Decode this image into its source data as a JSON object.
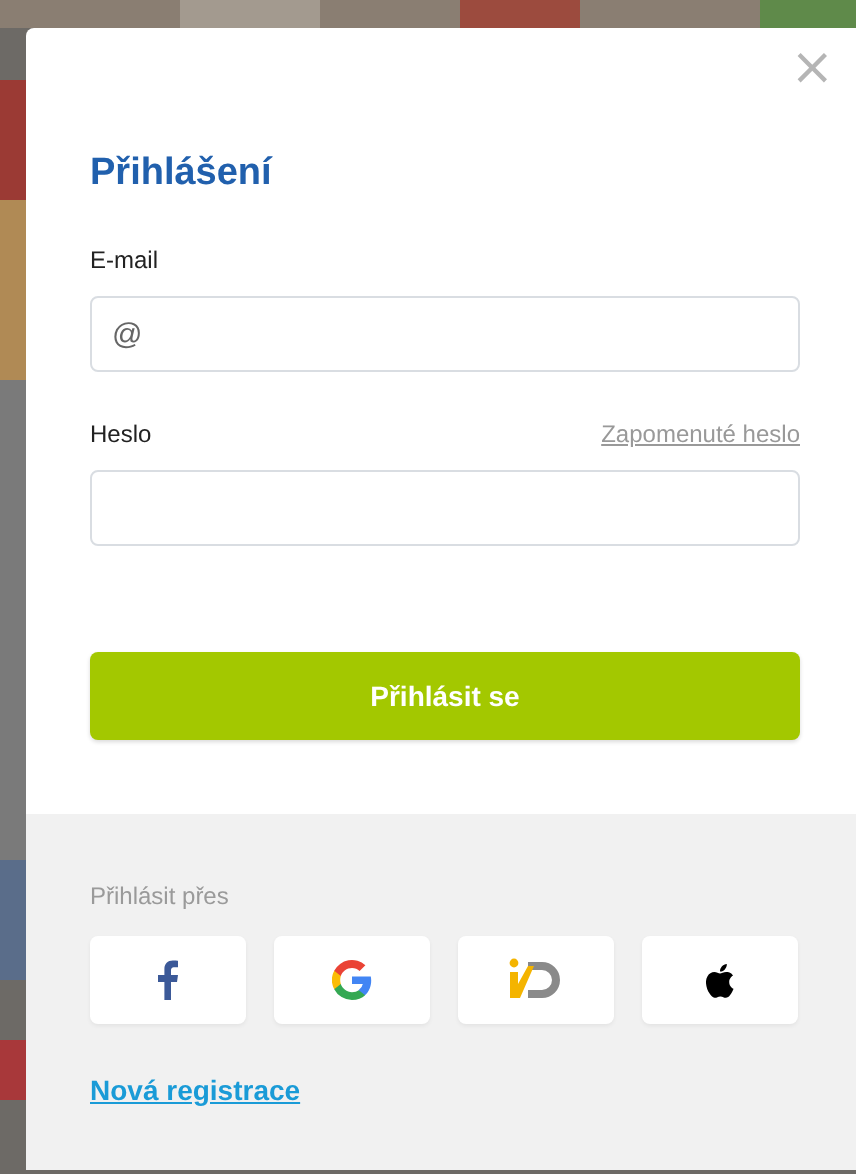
{
  "dialog": {
    "close": "×",
    "title": "Přihlášení",
    "email": {
      "label": "E-mail",
      "placeholder": "@"
    },
    "password": {
      "label": "Heslo",
      "forgot_link": "Zapomenuté heslo"
    },
    "submit": "Přihlásit se",
    "social": {
      "label": "Přihlásit přes",
      "providers": [
        {
          "kind": "facebook"
        },
        {
          "kind": "google"
        },
        {
          "kind": "id"
        },
        {
          "kind": "apple"
        }
      ]
    },
    "register_link": "Nová registrace"
  }
}
